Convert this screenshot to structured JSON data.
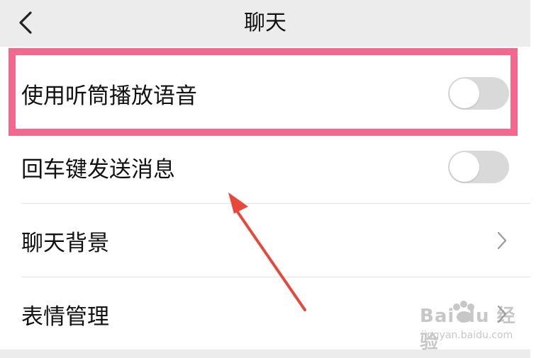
{
  "navbar": {
    "back_icon": "chevron-left-icon",
    "title": "聊天"
  },
  "settings": {
    "items": [
      {
        "label": "使用听筒播放语音",
        "control": "toggle",
        "on": false
      },
      {
        "label": "回车键发送消息",
        "control": "toggle",
        "on": false
      },
      {
        "label": "聊天背景",
        "control": "chevron",
        "icon": "chevron-right-icon"
      },
      {
        "label": "表情管理",
        "control": "chevron",
        "icon": "chevron-right-icon"
      }
    ]
  },
  "annotations": {
    "highlight_color": "#f2688f",
    "arrow_color": "#e8473a"
  },
  "watermark": {
    "brand": "Bai du 经验",
    "sub": "jingyan.baidu.com"
  },
  "colors": {
    "navbar_bg": "#ececec",
    "toggle_off": "#d9d9d9",
    "text": "#111111"
  }
}
